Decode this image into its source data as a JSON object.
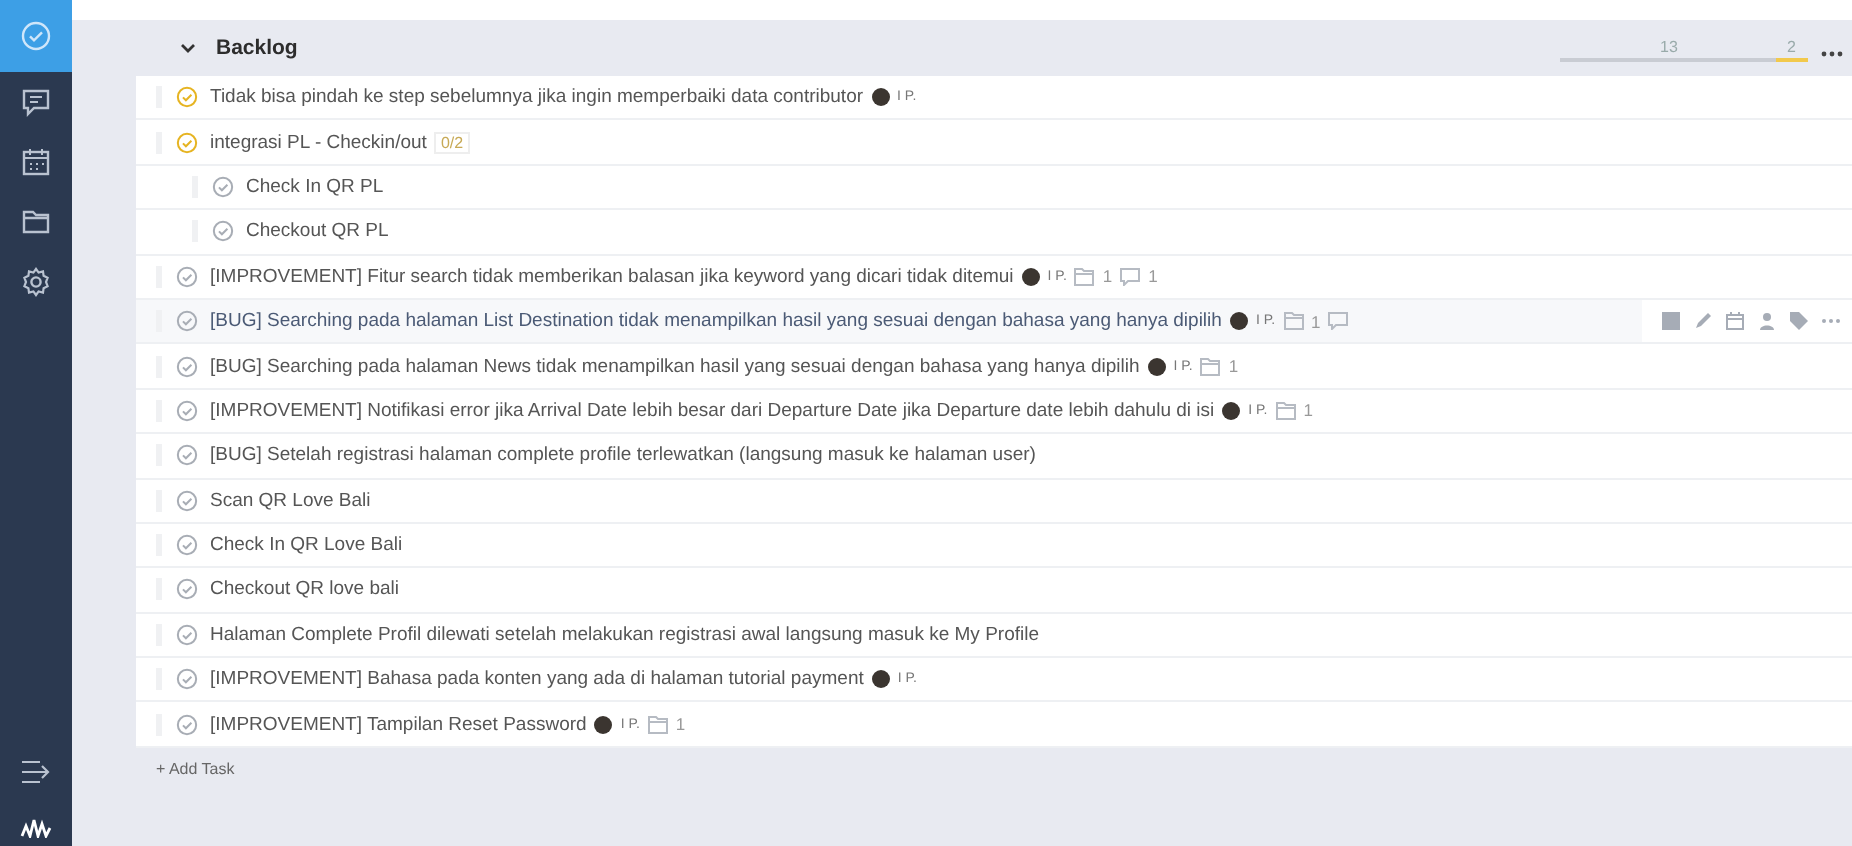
{
  "sidebar": {
    "items": [
      {
        "selected": true
      },
      {
        "selected": false
      },
      {
        "selected": false
      },
      {
        "selected": false
      },
      {
        "selected": false
      }
    ]
  },
  "section": {
    "title": "Backlog",
    "expanded": true,
    "progress": {
      "open_label": "13",
      "done_label": "2",
      "level": 0.13
    }
  },
  "tasks": [
    {
      "title": "Tidak bisa pindah ke step sebelumnya jika ingin memperbaiki data contributor",
      "started": true,
      "hovered": false,
      "assignee": "I P."
    },
    {
      "title": "integrasi PL - Checkin/out",
      "started": true,
      "hovered": false,
      "subtask_count": "0/2",
      "children": [
        {
          "title": "Check In QR PL",
          "started": false,
          "hovered": false
        },
        {
          "title": "Checkout QR PL",
          "started": false,
          "hovered": false
        }
      ]
    },
    {
      "title": "[IMPROVEMENT] Fitur search tidak memberikan balasan jika keyword yang dicari tidak ditemui",
      "started": false,
      "hovered": false,
      "assignee": "I P.",
      "attachments": "1",
      "comments": "1"
    },
    {
      "title": "[BUG] Searching pada halaman List Destination tidak menampilkan hasil yang sesuai dengan bahasa yang hanya dipilih",
      "started": false,
      "hovered": true,
      "assignee": "I P.",
      "attachments": "1",
      "comment_icon": true
    },
    {
      "title": "[BUG] Searching pada halaman News tidak menampilkan hasil yang sesuai dengan bahasa yang hanya dipilih",
      "started": false,
      "hovered": false,
      "assignee": "I P.",
      "attachments": "1"
    },
    {
      "title": "[IMPROVEMENT] Notifikasi error jika Arrival Date lebih besar dari Departure Date jika Departure date lebih dahulu di isi",
      "started": false,
      "hovered": false,
      "assignee": "I P.",
      "attachments": "1"
    },
    {
      "title": "[BUG] Setelah registrasi halaman complete profile terlewatkan (langsung masuk ke halaman user)",
      "started": false,
      "hovered": false
    },
    {
      "title": "Scan QR Love Bali",
      "started": false,
      "hovered": false
    },
    {
      "title": "Check In QR Love Bali",
      "started": false,
      "hovered": false
    },
    {
      "title": "Checkout QR love bali",
      "started": false,
      "hovered": false
    },
    {
      "title": "Halaman Complete Profil dilewati setelah melakukan registrasi awal langsung masuk ke My Profile",
      "started": false,
      "hovered": false
    },
    {
      "title": "[IMPROVEMENT] Bahasa pada konten yang ada di halaman tutorial payment",
      "started": false,
      "hovered": false,
      "assignee": "I P."
    },
    {
      "title": "[IMPROVEMENT] Tampilan Reset Password",
      "started": false,
      "hovered": false,
      "assignee": "I P.",
      "attachments": "1"
    }
  ],
  "add_task": "+ Add Task"
}
